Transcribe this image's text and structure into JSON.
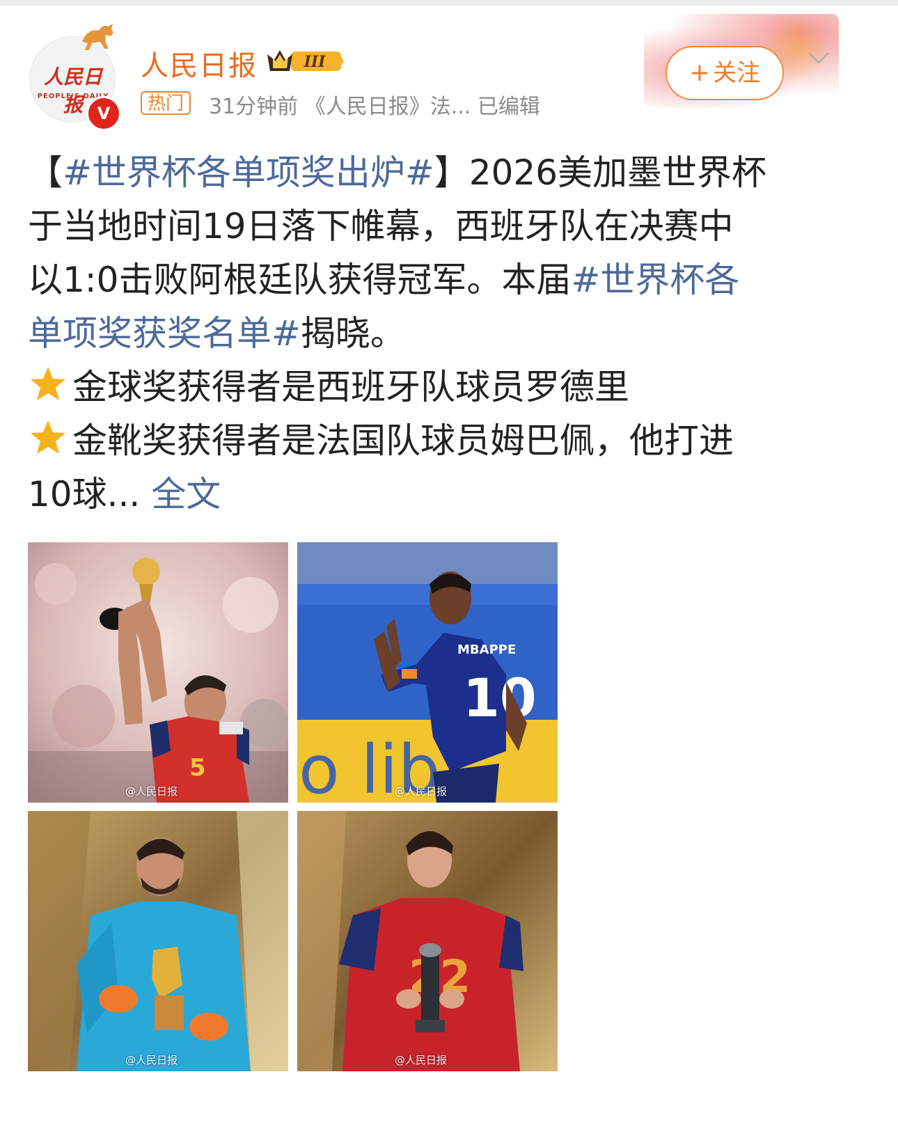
{
  "header": {
    "account_name": "人民日报",
    "avatar_text": "人民日报",
    "avatar_en": "PEOPLE'S DAILY",
    "verified_mark": "V",
    "level_badge": "III",
    "hot_tag": "热门",
    "meta_text": "31分钟前 《人民日报》法...  已编辑",
    "follow_label": "关注",
    "follow_plus": "+"
  },
  "post": {
    "line1": {
      "bracket_open": "【",
      "tag": "#世界杯各单项奖出炉#",
      "bracket_close": "】",
      "text": "2026美加墨世界杯"
    },
    "line2": "于当地时间19日落下帷幕，西班牙队在决赛中",
    "line3": {
      "text": "以1:0击败阿根廷队获得冠军。本届",
      "tag": "#世界杯各"
    },
    "line4": {
      "tag": "单项奖获奖名单#",
      "text": "揭晓。"
    },
    "line5": "金球奖获得者是西班牙队球员罗德里",
    "line6": "金靴奖获得者是法国队球员姆巴佩，他打进",
    "line7": {
      "text": "10球...",
      "more": "全文"
    }
  },
  "photos": [
    {
      "name": "photo-golden-ball",
      "watermark": "@人民日报"
    },
    {
      "name": "photo-golden-boot",
      "watermark": "@人民日报",
      "jersey_name": "MBAPPE",
      "jersey_number": "10",
      "banner_text": "o lib"
    },
    {
      "name": "photo-golden-glove",
      "watermark": "@人民日报"
    },
    {
      "name": "photo-best-young-player",
      "watermark": "@人民日报",
      "jersey_number": "22"
    }
  ],
  "colors": {
    "accent": "#f07d2a",
    "link": "#4c6a9a",
    "verified": "#e2231a",
    "star": "#f6b21b"
  }
}
